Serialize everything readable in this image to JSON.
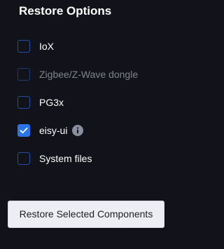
{
  "title": "Restore Options",
  "options": [
    {
      "label": "IoX",
      "checked": false,
      "disabled": false
    },
    {
      "label": "Zigbee/Z-Wave dongle",
      "checked": false,
      "disabled": true
    },
    {
      "label": "PG3x",
      "checked": false,
      "disabled": false
    },
    {
      "label": "eisy-ui",
      "checked": true,
      "disabled": false,
      "info_icon": "info-icon"
    },
    {
      "label": "System files",
      "checked": false,
      "disabled": false
    }
  ],
  "restore_button_label": "Restore Selected Components",
  "colors": {
    "background": "#12131a",
    "checkbox_border": "#1d4fa8",
    "checkbox_checked": "#2b74e6",
    "disabled_text": "#7f8390",
    "button_background": "#eceef3"
  }
}
